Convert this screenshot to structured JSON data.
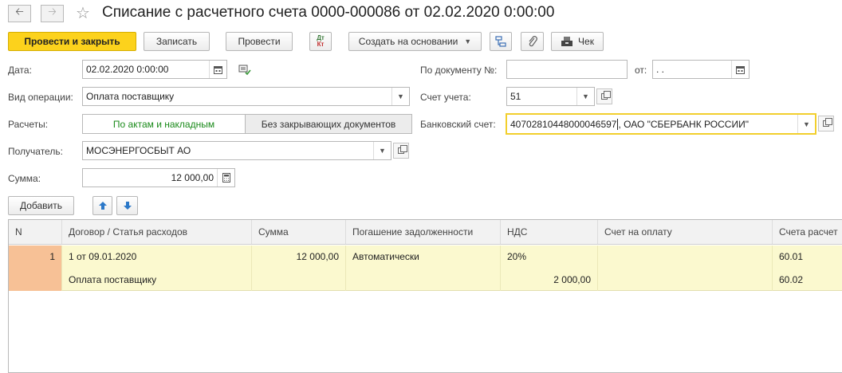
{
  "window": {
    "title": "Списание с расчетного счета 0000-000086 от 02.02.2020 0:00:00"
  },
  "toolbar": {
    "post_close": "Провести и закрыть",
    "save": "Записать",
    "post": "Провести",
    "dtkt_top": "Дт",
    "dtkt_bottom": "Кт",
    "create_based": "Создать на основании",
    "check": "Чек"
  },
  "form": {
    "date_label": "Дата:",
    "date_value": "02.02.2020  0:00:00",
    "operation_label": "Вид операции:",
    "operation_value": "Оплата поставщику",
    "settlements_label": "Расчеты:",
    "settlements_option_acts": "По актам и накладным",
    "settlements_option_none": "Без закрывающих документов",
    "recipient_label": "Получатель:",
    "recipient_value": "МОСЭНЕРГОСБЫТ АО",
    "amount_label": "Сумма:",
    "amount_value": "12 000,00",
    "doc_no_label": "По документу №:",
    "doc_no_value": "",
    "from_label": "от:",
    "from_value": " .  .",
    "account_label": "Счет учета:",
    "account_value": "51",
    "bank_label": "Банковский счет:",
    "bank_number": "40702810448000046597",
    "bank_rest": ", ОАО \"СБЕРБАНК РОССИИ\""
  },
  "table_toolbar": {
    "add": "Добавить"
  },
  "table": {
    "columns": [
      "N",
      "Договор / Статья расходов",
      "Сумма",
      "Погашение задолженности",
      "НДС",
      "Счет на оплату",
      "Счета расчет"
    ],
    "rows": [
      {
        "n": "1",
        "contract": "1 от 09.01.2020",
        "expense": "Оплата поставщику",
        "amount": "12 000,00",
        "repayment": "Автоматически",
        "vat_rate": "20%",
        "vat_amount": "2 000,00",
        "invoice": "",
        "account1": "60.01",
        "account2": "60.02"
      }
    ]
  },
  "colors": {
    "accent": "#fcd21c",
    "row_highlight": "#fbf9cf",
    "number_cell": "#f7c196",
    "switch_active_text": "#1a8a1a"
  }
}
